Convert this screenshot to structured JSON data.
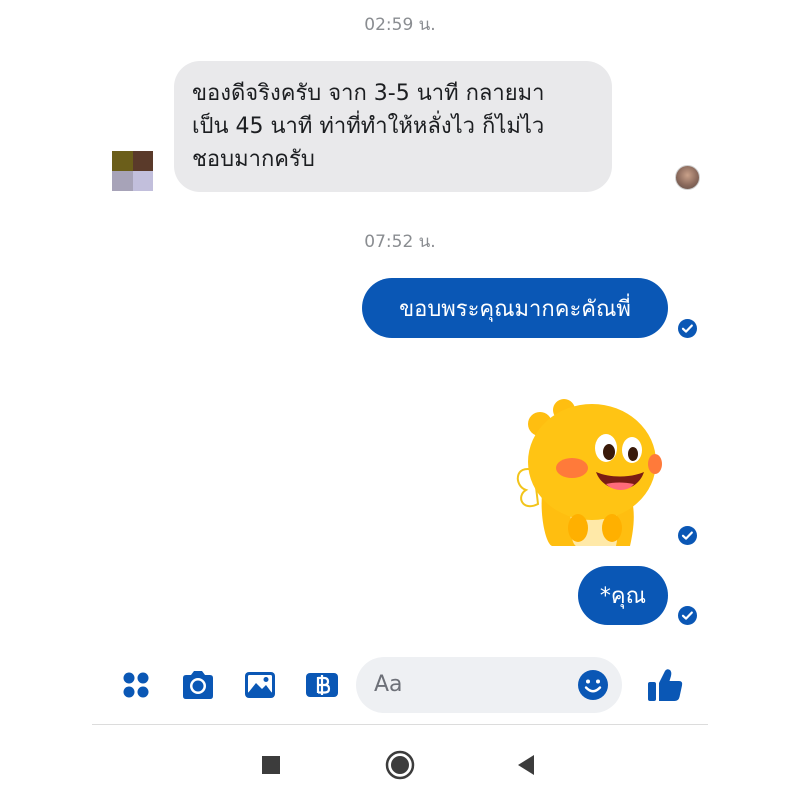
{
  "conversation": {
    "timestamps": [
      "02:59 น.",
      "07:52 น."
    ],
    "incoming_message": {
      "lines": [
        "ของดีจริงครับ จาก 3-5 นาที กลายมา",
        "เป็น 45 นาที ท่าที่ทำให้หลั่งไว ก็ไม่ไว",
        "ชอบมากครับ"
      ]
    },
    "outgoing_messages": [
      "ขอบพระคุณมากคะคัณพี่",
      "*คุณ"
    ],
    "sticker": "yellow-dinosaur-sticker"
  },
  "composer": {
    "placeholder": "Aa",
    "tools": [
      "menu-icon",
      "camera-icon",
      "gallery-icon",
      "payment-icon"
    ],
    "emoji_icon": "emoji-icon",
    "send_icon": "thumbs-up-icon"
  },
  "navigation": [
    "recent-apps-icon",
    "home-icon",
    "back-icon"
  ],
  "colors": {
    "accent": "#0a57b5",
    "incoming_bubble": "#e9e9eb",
    "timestamp": "#8a8d91",
    "input_background": "#eef0f3"
  }
}
